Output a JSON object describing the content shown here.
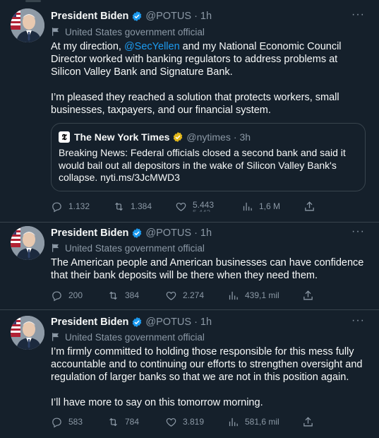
{
  "colors": {
    "background": "#15202b",
    "text": "#f7f9f9",
    "muted": "#8b98a5",
    "link": "#1d9bf0",
    "border": "#38444d",
    "verified_blue": "#1d9bf0",
    "verified_gold": "#e2b719"
  },
  "tweets": [
    {
      "author": "President Biden",
      "handle": "@POTUS",
      "separator": "·",
      "time": "1h",
      "affiliation": "United States government official",
      "more": "···",
      "text_before": "At my direction, ",
      "mention": "@SecYellen",
      "text_after": " and my National Economic Council Director worked with banking regulators to address problems at Silicon Valley Bank and Signature Bank.\n\nI’m pleased they reached a solution that protects workers, small businesses, taxpayers, and our financial system.",
      "quote": {
        "logo": "𝕿",
        "author": "The New York Times",
        "handle": "@nytimes",
        "separator": "·",
        "time": "3h",
        "text": "Breaking News: Federal officials closed a second bank and said it would bail out all depositors in the wake of Silicon Valley Bank's collapse. nyti.ms/3JcMWD3"
      },
      "stats": {
        "replies": "1.132",
        "retweets": "1.384",
        "likes": "5.443",
        "likes_ghost": "5.442",
        "views": "1,6 M"
      }
    },
    {
      "author": "President Biden",
      "handle": "@POTUS",
      "separator": "·",
      "time": "1h",
      "affiliation": "United States government official",
      "more": "···",
      "text": "The American people and American businesses can have confidence that their bank deposits will be there when they need them.",
      "stats": {
        "replies": "200",
        "retweets": "384",
        "likes": "2.274",
        "views": "439,1 mil"
      }
    },
    {
      "author": "President Biden",
      "handle": "@POTUS",
      "separator": "·",
      "time": "1h",
      "affiliation": "United States government official",
      "more": "···",
      "text": "I’m firmly committed to holding those responsible for this mess fully accountable and to continuing our efforts to strengthen oversight and regulation of larger banks so that we are not in this position again.\n\nI’ll have more to say on this tomorrow morning.",
      "stats": {
        "replies": "583",
        "retweets": "784",
        "likes": "3.819",
        "views": "581,6 mil"
      }
    }
  ]
}
